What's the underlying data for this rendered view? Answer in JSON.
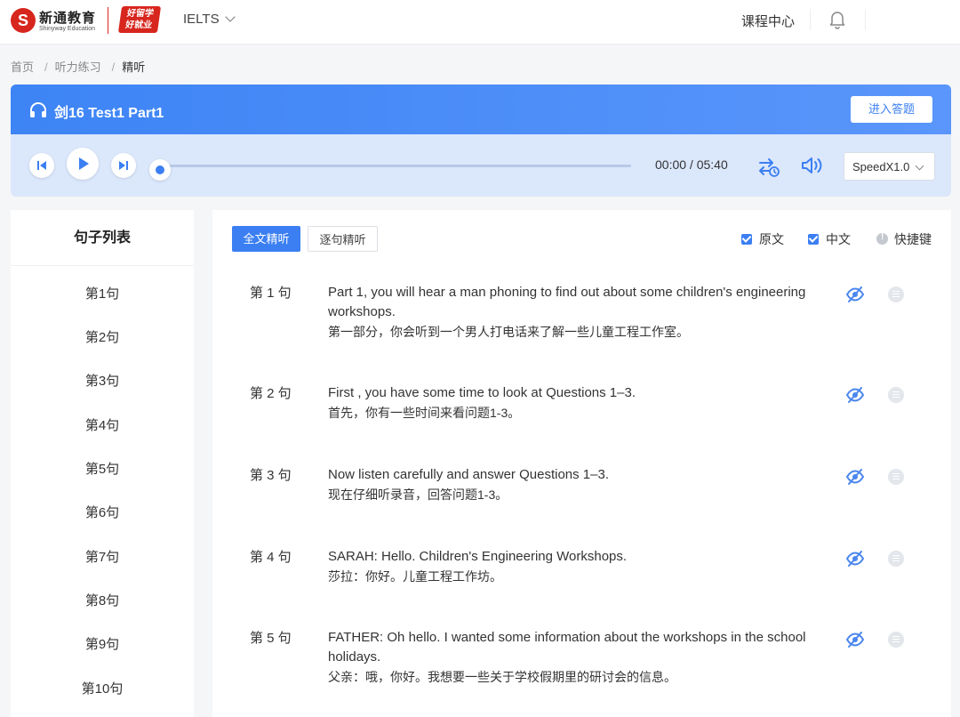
{
  "brand": {
    "mark": "S",
    "name": "新通教育",
    "sub": "Shinyway Education",
    "badge_line1": "好留学",
    "badge_line2": "好就业"
  },
  "topbar": {
    "exam": "IELTS",
    "course_center": "课程中心"
  },
  "breadcrumb": [
    "首页",
    "听力练习",
    "精听"
  ],
  "breadcrumb_sep": "/",
  "player": {
    "title": "剑16 Test1 Part1",
    "enter_button": "进入答题",
    "current_time": "00:00",
    "total_time": "05:40",
    "progress": 0,
    "speed": "SpeedX1.0",
    "accent": "#3b7ff2"
  },
  "sentence_list": {
    "title": "句子列表",
    "items": [
      "第1句",
      "第2句",
      "第3句",
      "第4句",
      "第5句",
      "第6句",
      "第7句",
      "第8句",
      "第9句",
      "第10句"
    ]
  },
  "tabs": {
    "full": "全文精听",
    "sentence": "逐句精听"
  },
  "options": {
    "original": "原文",
    "chinese": "中文",
    "shortcut": "快捷键"
  },
  "sentences": [
    {
      "label": "第 1 句",
      "en": "Part 1, you will hear a man phoning to find out about some children's engineering workshops.",
      "zh": "第一部分，你会听到一个男人打电话来了解一些儿童工程工作室。"
    },
    {
      "label": "第 2 句",
      "en": "First , you have some time to look at Questions 1–3.",
      "zh": "首先，你有一些时间来看问题1-3。"
    },
    {
      "label": "第 3 句",
      "en": "Now listen carefully and answer Questions 1–3.",
      "zh": "现在仔细听录音，回答问题1-3。"
    },
    {
      "label": "第 4 句",
      "en": "SARAH: Hello. Children's Engineering Workshops.",
      "zh": "莎拉：你好。儿童工程工作坊。"
    },
    {
      "label": "第 5 句",
      "en": "FATHER: Oh hello. I wanted some information about the workshops in the school holidays.",
      "zh": "父亲：哦，你好。我想要一些关于学校假期里的研讨会的信息。"
    }
  ]
}
